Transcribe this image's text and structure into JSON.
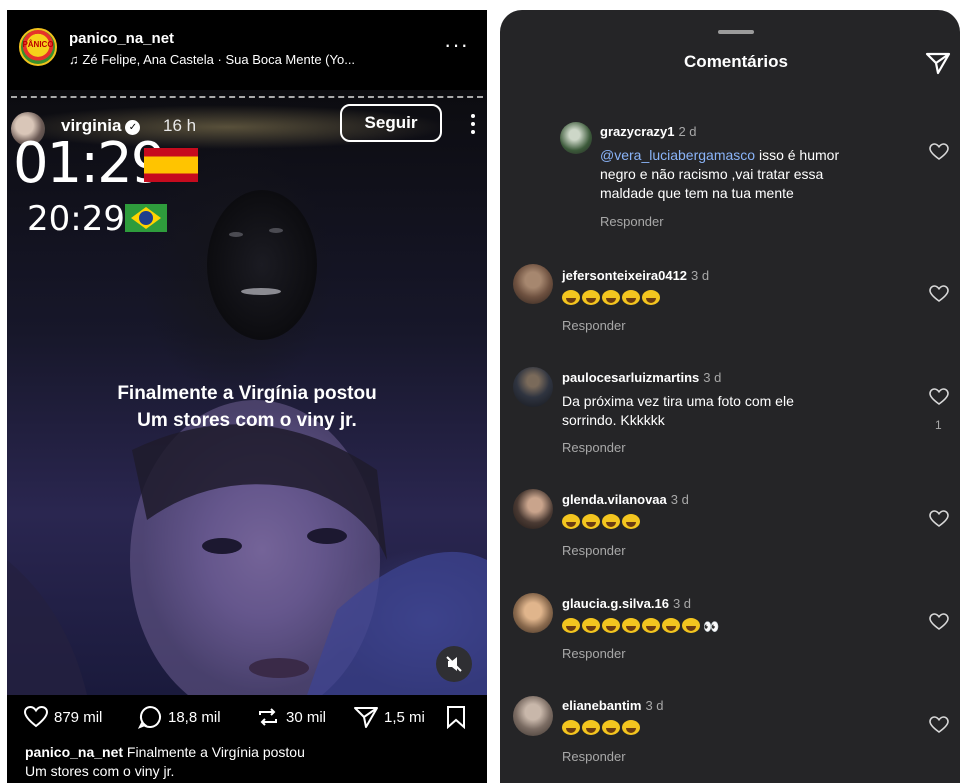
{
  "post": {
    "username": "panico_na_net",
    "avatar_text": "PÂNICO",
    "music": "Zé Felipe, Ana Castela · Sua Boca Mente (Yo...",
    "more": "···"
  },
  "story": {
    "username": "virginia",
    "verified": "✓",
    "time_ago": "16 h",
    "follow_label": "Seguir",
    "clock_spain": "01:29",
    "clock_brazil": "20:29",
    "caption_line1": "Finalmente a Virgínia postou",
    "caption_line2": "Um stores com o viny jr."
  },
  "actions": {
    "likes": "879 mil",
    "comments": "18,8 mil",
    "reposts": "30 mil",
    "shares": "1,5 mi"
  },
  "post_caption": {
    "username": "panico_na_net",
    "text": " Finalmente a Virgínia postou",
    "line2": "Um stores com o viny jr."
  },
  "comments_panel": {
    "title": "Comentários",
    "reply_label": "Responder",
    "items": [
      {
        "username": "grazycrazy1",
        "ago": "2 d",
        "mention": "@vera_luciabergamasco",
        "text1": " isso é humor",
        "text2": "negro e não racismo ,vai tratar essa",
        "text3": "maldade que tem na tua mente",
        "avatar_color": "#3c5a3a"
      },
      {
        "username": "jefersonteixeira0412",
        "ago": "3 d",
        "emoji_count": 5,
        "avatar_color": "#6e5140"
      },
      {
        "username": "paulocesarluizmartins",
        "ago": "3 d",
        "text1": "Da próxima vez tira uma foto com ele",
        "text2": "sorrindo. Kkkkkk",
        "like_count": "1",
        "avatar_color": "#2f3440"
      },
      {
        "username": "glenda.vilanovaa",
        "ago": "3 d",
        "emoji_count": 4,
        "avatar_color": "#4a3a33"
      },
      {
        "username": "glaucia.g.silva.16",
        "ago": "3 d",
        "emoji_count": 7,
        "eyes": "👀",
        "avatar_color": "#8a6a4e"
      },
      {
        "username": "elianebantim",
        "ago": "3 d",
        "emoji_count": 4,
        "avatar_color": "#7b6c63"
      }
    ]
  }
}
